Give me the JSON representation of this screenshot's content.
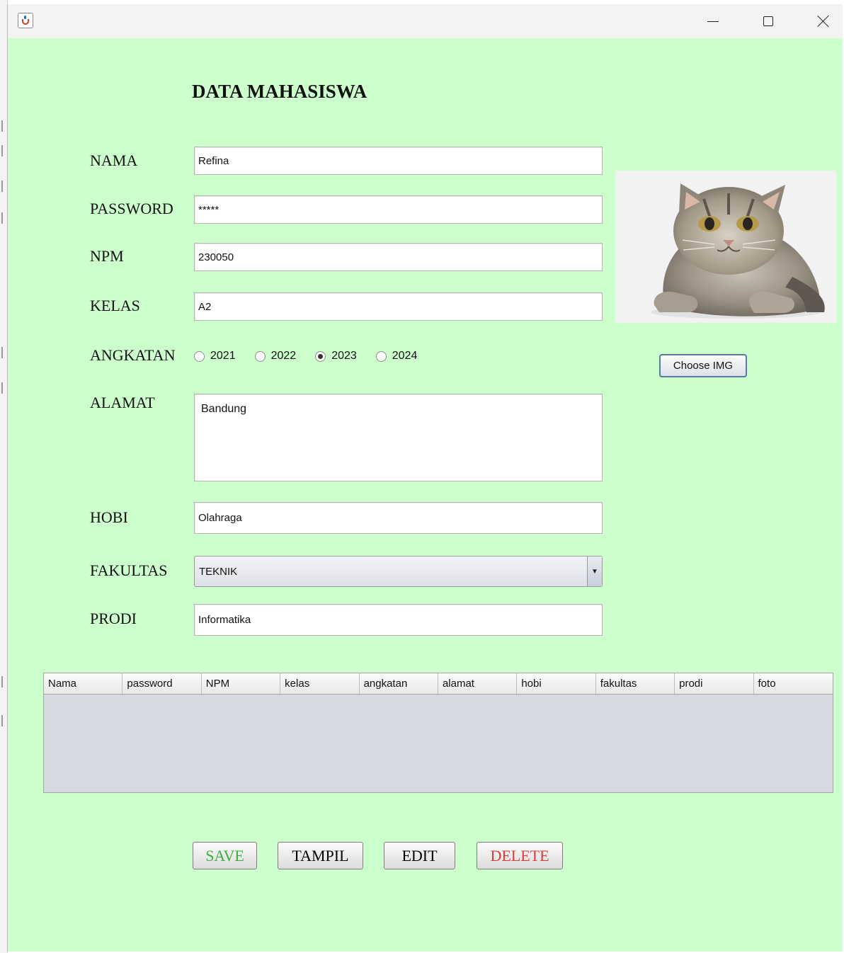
{
  "window": {
    "controls": {
      "minimize": "minimize-icon",
      "maximize": "maximize-icon",
      "close": "close-icon"
    }
  },
  "form": {
    "title": "DATA MAHASISWA",
    "labels": {
      "nama": "NAMA",
      "password": "PASSWORD",
      "npm": "NPM",
      "kelas": "KELAS",
      "angkatan": "ANGKATAN",
      "alamat": "ALAMAT",
      "hobi": "HOBI",
      "fakultas": "FAKULTAS",
      "prodi": "PRODI"
    },
    "values": {
      "nama": "Refina",
      "password": "*****",
      "npm": "230050",
      "kelas": "A2",
      "alamat": "Bandung",
      "hobi": "Olahraga",
      "fakultas": "TEKNIK",
      "prodi": "Informatika"
    },
    "angkatan_options": [
      "2021",
      "2022",
      "2023",
      "2024"
    ],
    "angkatan_selected": "2023"
  },
  "photo": {
    "subject": "cat-photo",
    "choose_label": "Choose IMG"
  },
  "table": {
    "columns": [
      "Nama",
      "password",
      "NPM",
      "kelas",
      "angkatan",
      "alamat",
      "hobi",
      "fakultas",
      "prodi",
      "foto"
    ],
    "rows": []
  },
  "actions": {
    "save": "SAVE",
    "tampil": "TAMPIL",
    "edit": "EDIT",
    "delete": "DELETE"
  },
  "colors": {
    "background": "#ccffcc",
    "save_text": "#3cb03c",
    "delete_text": "#e23a3a"
  }
}
